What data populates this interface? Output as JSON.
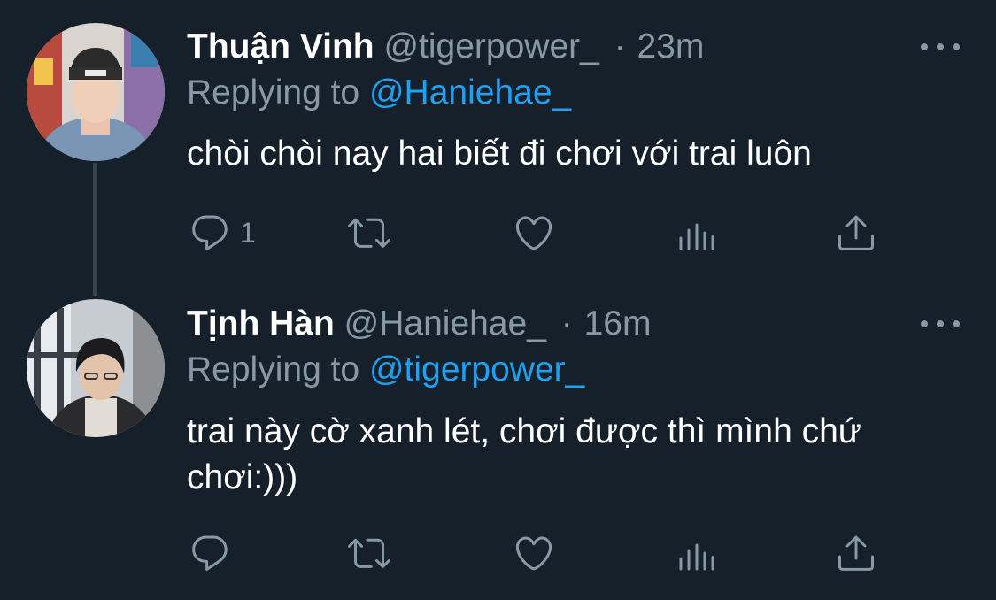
{
  "thread": [
    {
      "display_name": "Thuận Vinh",
      "handle": "@tigerpower_",
      "separator": "·",
      "time": "23m",
      "reply_prefix": "Replying to",
      "reply_to": "@Haniehae_",
      "text": "chòi chòi nay hai biết đi chơi với trai luôn",
      "reply_count": "1",
      "more_icon": "more-horizontal-icon"
    },
    {
      "display_name": "Tịnh Hàn",
      "handle": "@Haniehae_",
      "separator": "·",
      "time": "16m",
      "reply_prefix": "Replying to",
      "reply_to": "@tigerpower_",
      "text": "trai này cờ xanh lét, chơi được thì mình chứ chơi:)))",
      "reply_count": "",
      "more_icon": "more-horizontal-icon"
    }
  ],
  "action_icons": [
    "reply-icon",
    "retweet-icon",
    "like-icon",
    "views-icon",
    "share-icon"
  ],
  "colors": {
    "background": "#15202b",
    "primary_text": "#ffffff",
    "secondary_text": "#8899a6",
    "link": "#1da1f2",
    "thread_line": "#38444d"
  }
}
